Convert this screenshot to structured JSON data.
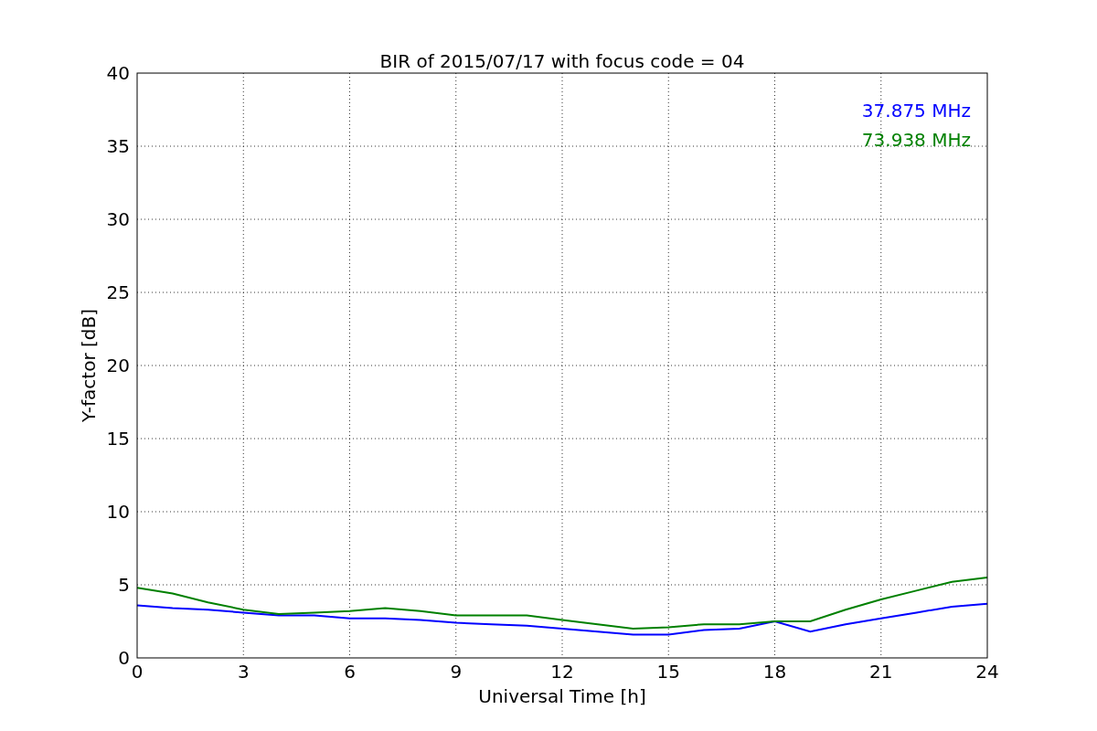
{
  "figure": {
    "chart_data": {
      "type": "line",
      "title": "BIR of 2015/07/17 with focus code = 04",
      "xlabel": "Universal Time [h]",
      "ylabel": "Y-factor [dB]",
      "x": [
        0,
        1,
        2,
        3,
        4,
        5,
        6,
        7,
        8,
        9,
        10,
        11,
        12,
        13,
        14,
        15,
        16,
        17,
        18,
        19,
        20,
        21,
        22,
        23,
        24
      ],
      "series": [
        {
          "name": "37.875 MHz",
          "color": "#0000ff",
          "values": [
            3.6,
            3.4,
            3.3,
            3.1,
            2.9,
            2.9,
            2.7,
            2.7,
            2.6,
            2.4,
            2.3,
            2.2,
            2.0,
            1.8,
            1.6,
            1.6,
            1.9,
            2.0,
            2.5,
            1.8,
            2.3,
            2.7,
            3.1,
            3.5,
            3.7
          ]
        },
        {
          "name": "73.938 MHz",
          "color": "#008000",
          "values": [
            4.8,
            4.4,
            3.8,
            3.3,
            3.0,
            3.1,
            3.2,
            3.4,
            3.2,
            2.9,
            2.9,
            2.9,
            2.6,
            2.3,
            2.0,
            2.1,
            2.3,
            2.3,
            2.5,
            2.5,
            3.3,
            4.0,
            4.6,
            5.2,
            5.5
          ]
        }
      ],
      "grid": true,
      "xlim": [
        0,
        24
      ],
      "ylim": [
        0,
        40
      ],
      "xticks": [
        0,
        3,
        6,
        9,
        12,
        15,
        18,
        21,
        24
      ],
      "yticks": [
        0,
        5,
        10,
        15,
        20,
        25,
        30,
        35,
        40
      ]
    }
  }
}
